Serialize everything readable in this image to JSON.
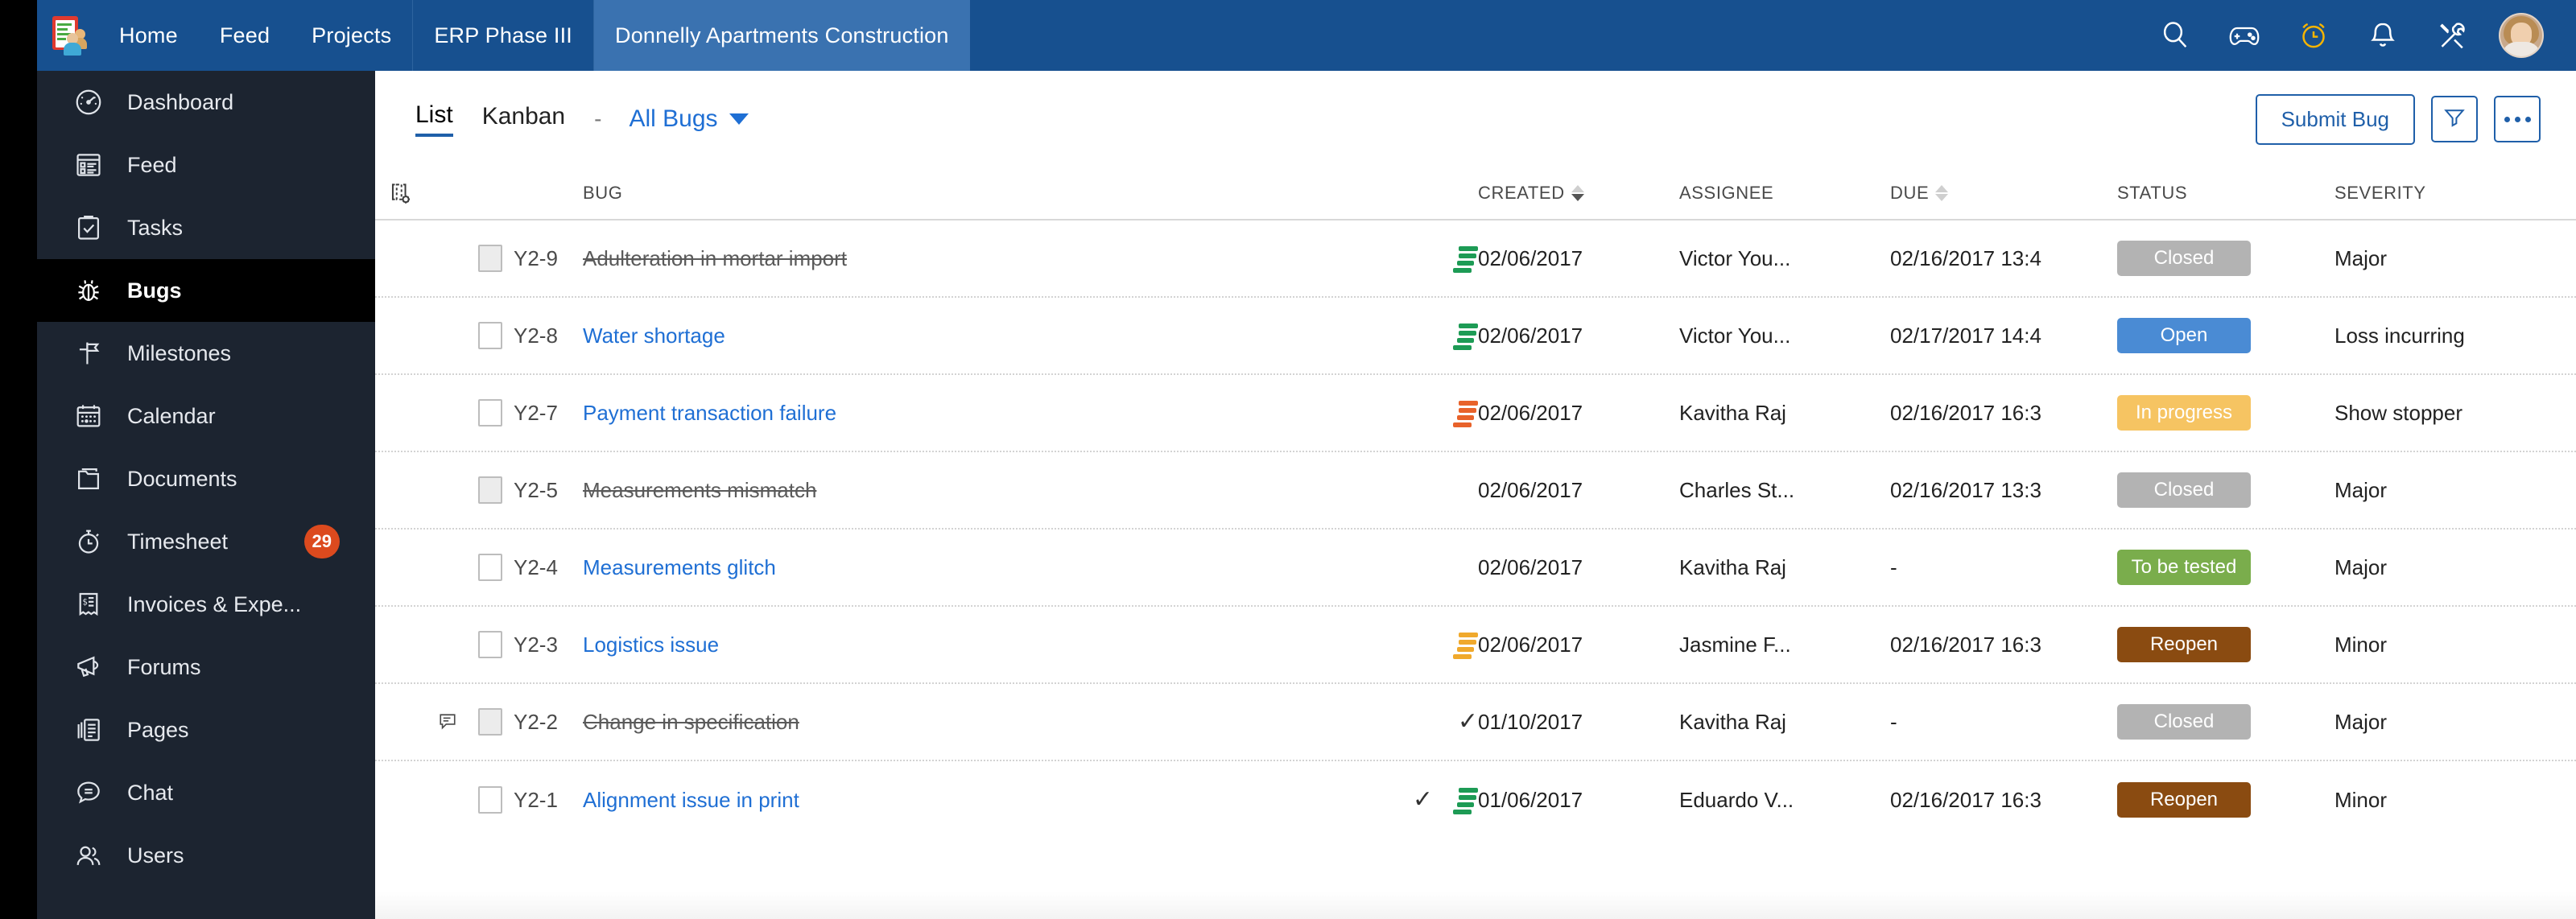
{
  "topnav": {
    "logo_name": "zoho-projects-logo",
    "items": [
      {
        "label": "Home",
        "active": false,
        "sep": false
      },
      {
        "label": "Feed",
        "active": false,
        "sep": false
      },
      {
        "label": "Projects",
        "active": false,
        "sep": false
      },
      {
        "label": "ERP Phase III",
        "active": false,
        "sep": true
      },
      {
        "label": "Donnelly Apartments Construction",
        "active": true,
        "sep": true
      }
    ],
    "icons": [
      "search-icon",
      "gamepad-icon",
      "timer-icon",
      "bell-icon",
      "tools-icon"
    ],
    "avatar_label": "user-avatar"
  },
  "sidebar": {
    "items": [
      {
        "label": "Dashboard",
        "icon": "speedometer-icon",
        "active": false,
        "badge": ""
      },
      {
        "label": "Feed",
        "icon": "feed-icon",
        "active": false,
        "badge": ""
      },
      {
        "label": "Tasks",
        "icon": "clipboard-check-icon",
        "active": false,
        "badge": ""
      },
      {
        "label": "Bugs",
        "icon": "bug-icon",
        "active": true,
        "badge": ""
      },
      {
        "label": "Milestones",
        "icon": "flag-icon",
        "active": false,
        "badge": ""
      },
      {
        "label": "Calendar",
        "icon": "calendar-icon",
        "active": false,
        "badge": ""
      },
      {
        "label": "Documents",
        "icon": "folder-icon",
        "active": false,
        "badge": ""
      },
      {
        "label": "Timesheet",
        "icon": "stopwatch-icon",
        "active": false,
        "badge": "29"
      },
      {
        "label": "Invoices & Expe...",
        "icon": "invoice-icon",
        "active": false,
        "badge": ""
      },
      {
        "label": "Forums",
        "icon": "megaphone-icon",
        "active": false,
        "badge": ""
      },
      {
        "label": "Pages",
        "icon": "pages-icon",
        "active": false,
        "badge": ""
      },
      {
        "label": "Chat",
        "icon": "chat-icon",
        "active": false,
        "badge": ""
      },
      {
        "label": "Users",
        "icon": "users-icon",
        "active": false,
        "badge": ""
      }
    ]
  },
  "toolbar": {
    "tab_list": "List",
    "tab_kanban": "Kanban",
    "separator": "-",
    "filter_label": "All Bugs",
    "submit_label": "Submit Bug",
    "filter_icon": "funnel-icon",
    "more_icon": "more-options-icon"
  },
  "table": {
    "headers": {
      "gear": "column-settings-icon",
      "bug": "BUG",
      "created": "CREATED",
      "assignee": "ASSIGNEE",
      "due": "DUE",
      "status": "STATUS",
      "severity": "SEVERITY"
    },
    "sort": {
      "created": "desc",
      "due": "none"
    },
    "rows": [
      {
        "key": "Y2-9",
        "title": "Adulteration in mortar import",
        "struck": true,
        "has_note": false,
        "has_tick": false,
        "priority": "green",
        "created": "02/06/2017",
        "assignee": "Victor You...",
        "due": "02/16/2017 13:4",
        "status": "Closed",
        "status_color": "#b3b3b3",
        "severity": "Major"
      },
      {
        "key": "Y2-8",
        "title": "Water shortage",
        "struck": false,
        "has_note": false,
        "has_tick": false,
        "priority": "green",
        "created": "02/06/2017",
        "assignee": "Victor You...",
        "due": "02/17/2017 14:4",
        "status": "Open",
        "status_color": "#4a8bd4",
        "severity": "Loss incurring"
      },
      {
        "key": "Y2-7",
        "title": "Payment transaction failure",
        "struck": false,
        "has_note": false,
        "has_tick": false,
        "priority": "orange",
        "created": "02/06/2017",
        "assignee": "Kavitha Raj",
        "due": "02/16/2017 16:3",
        "status": "In progress",
        "status_color": "#f6c462",
        "severity": "Show stopper"
      },
      {
        "key": "Y2-5",
        "title": "Measurements mismatch",
        "struck": true,
        "has_note": false,
        "has_tick": false,
        "priority": "none",
        "created": "02/06/2017",
        "assignee": "Charles St...",
        "due": "02/16/2017 13:3",
        "status": "Closed",
        "status_color": "#b3b3b3",
        "severity": "Major"
      },
      {
        "key": "Y2-4",
        "title": "Measurements glitch",
        "struck": false,
        "has_note": false,
        "has_tick": false,
        "priority": "none",
        "created": "02/06/2017",
        "assignee": "Kavitha Raj",
        "due": "-",
        "status": "To be tested",
        "status_color": "#7aad4c",
        "severity": "Major"
      },
      {
        "key": "Y2-3",
        "title": "Logistics issue",
        "struck": false,
        "has_note": false,
        "has_tick": false,
        "priority": "amber",
        "created": "02/06/2017",
        "assignee": "Jasmine F...",
        "due": "02/16/2017 16:3",
        "status": "Reopen",
        "status_color": "#8a4b11",
        "severity": "Minor"
      },
      {
        "key": "Y2-2",
        "title": "Change in specification",
        "struck": true,
        "has_note": true,
        "has_tick": true,
        "priority": "none",
        "created": "01/10/2017",
        "assignee": "Kavitha Raj",
        "due": "-",
        "status": "Closed",
        "status_color": "#b3b3b3",
        "severity": "Major"
      },
      {
        "key": "Y2-1",
        "title": "Alignment issue in print",
        "struck": false,
        "has_note": false,
        "has_tick": true,
        "priority": "green",
        "created": "01/06/2017",
        "assignee": "Eduardo V...",
        "due": "02/16/2017 16:3",
        "status": "Reopen",
        "status_color": "#8a4b11",
        "severity": "Minor"
      }
    ]
  },
  "colors": {
    "topbar": "#17508f",
    "topbar_active_tab": "#3a72b0",
    "sidebar": "#1c2430",
    "sidebar_active": "#000000",
    "link": "#1f6fd4",
    "accent": "#1f5fa9",
    "badge": "#dc4a1e",
    "priority_green": "#1d9b55",
    "priority_orange": "#e8622a",
    "priority_amber": "#f0a92c"
  }
}
